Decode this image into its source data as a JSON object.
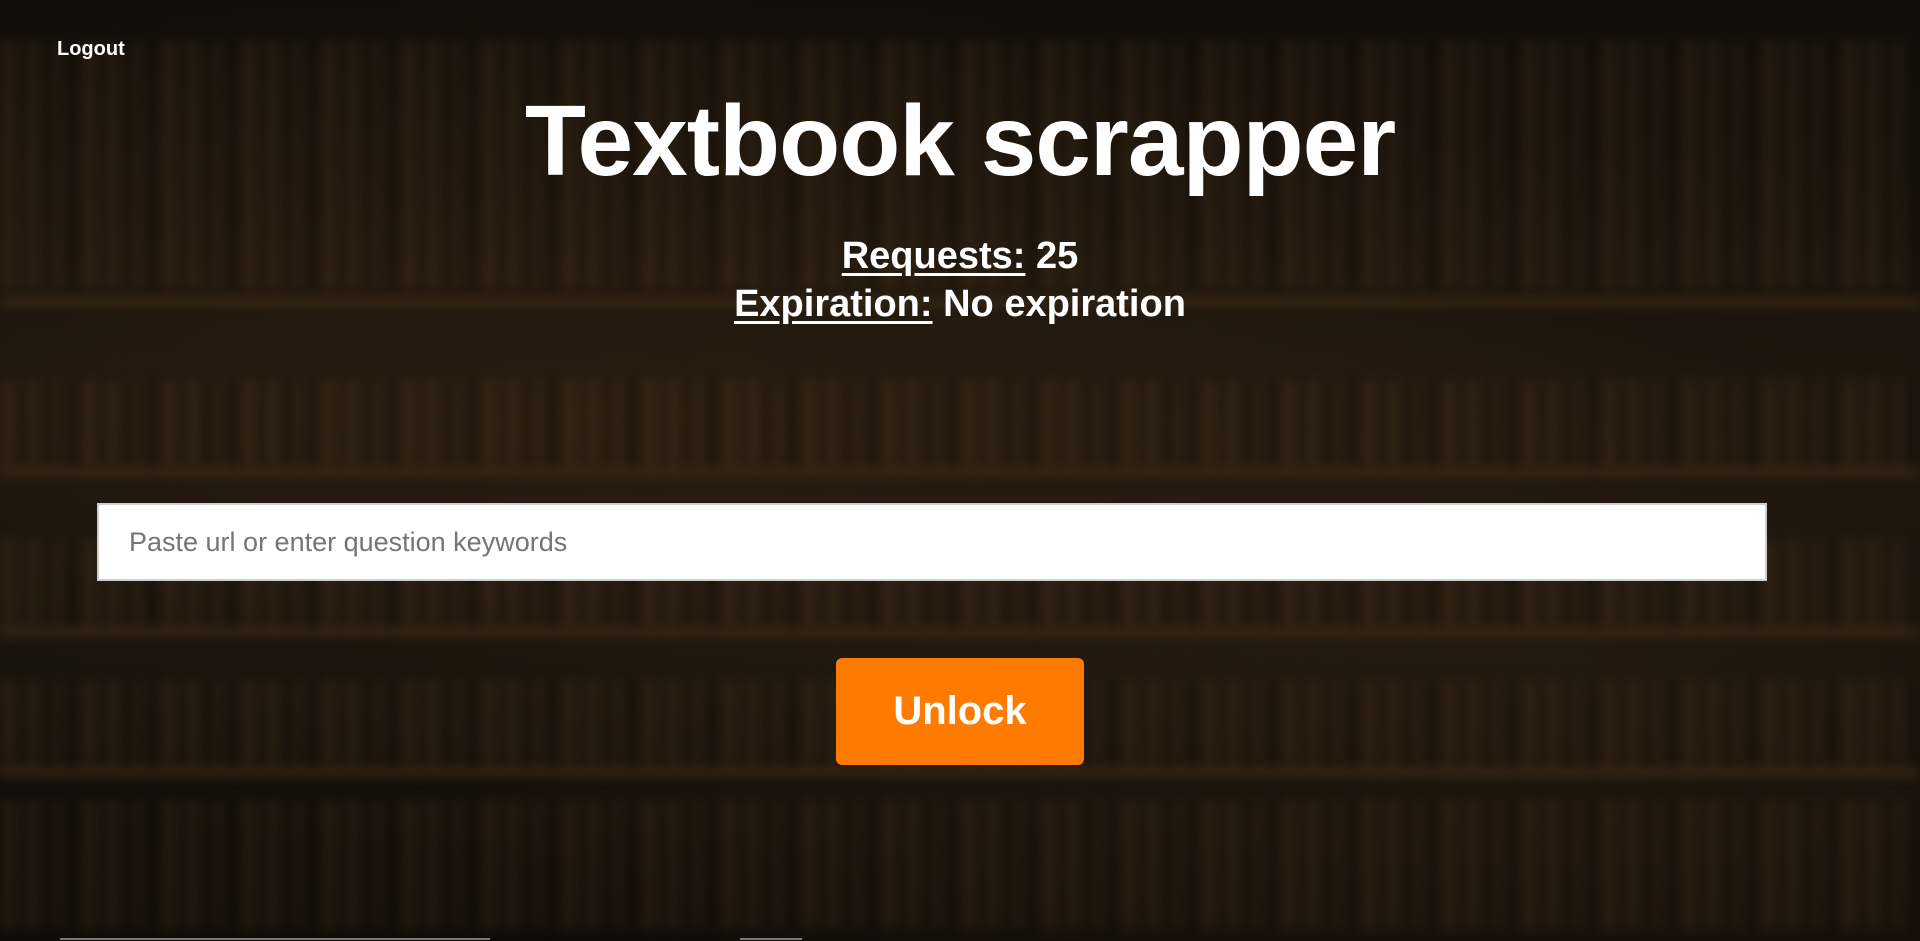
{
  "header": {
    "logout_label": "Logout"
  },
  "main": {
    "title": "Textbook scrapper",
    "requests_label": "Requests:",
    "requests_value": "25",
    "expiration_label": "Expiration:",
    "expiration_value": "No expiration"
  },
  "search": {
    "placeholder": "Paste url or enter question keywords",
    "value": ""
  },
  "actions": {
    "unlock_label": "Unlock"
  },
  "colors": {
    "accent": "#ff7a00",
    "text": "#ffffff",
    "background": "#120d08"
  }
}
